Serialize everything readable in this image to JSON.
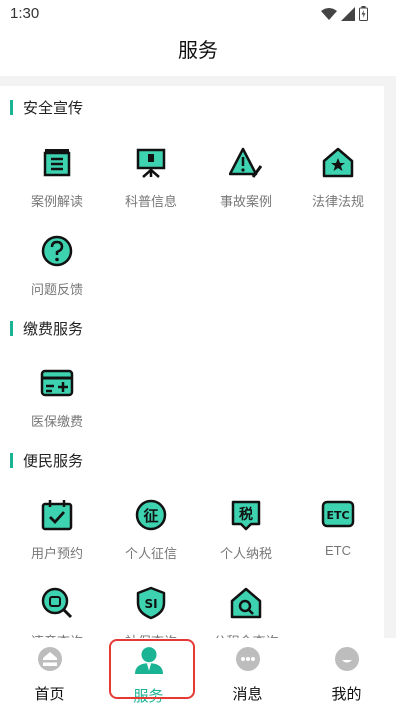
{
  "status_bar": {
    "time": "1:30"
  },
  "header": {
    "title": "服务"
  },
  "sections": [
    {
      "title": "安全宣传",
      "items": [
        {
          "label": "案例解读",
          "icon": "document-list-icon"
        },
        {
          "label": "科普信息",
          "icon": "presentation-board-icon"
        },
        {
          "label": "事故案例",
          "icon": "warning-pen-icon"
        },
        {
          "label": "法律法规",
          "icon": "house-star-icon"
        },
        {
          "label": "问题反馈",
          "icon": "question-circle-icon"
        }
      ]
    },
    {
      "title": "缴费服务",
      "items": [
        {
          "label": "医保缴费",
          "icon": "card-plus-icon"
        }
      ]
    },
    {
      "title": "便民服务",
      "items": [
        {
          "label": "用户预约",
          "icon": "calendar-check-icon"
        },
        {
          "label": "个人征信",
          "icon": "credit-circle-icon"
        },
        {
          "label": "个人纳税",
          "icon": "tax-seal-icon"
        },
        {
          "label": "ETC",
          "icon": "etc-icon"
        },
        {
          "label": "违章查询",
          "icon": "violation-search-icon"
        },
        {
          "label": "社保查询",
          "icon": "social-security-shield-icon"
        },
        {
          "label": "公积金查询",
          "icon": "house-search-icon"
        }
      ]
    }
  ],
  "tabs": [
    {
      "label": "首页",
      "icon": "home-icon",
      "active": false
    },
    {
      "label": "服务",
      "icon": "person-icon",
      "active": true
    },
    {
      "label": "消息",
      "icon": "message-dots-icon",
      "active": false
    },
    {
      "label": "我的",
      "icon": "profile-icon",
      "active": false
    }
  ],
  "colors": {
    "accent": "#1ab394",
    "icon_fill": "#3dd3b0",
    "highlight": "#e53935",
    "tab_icon": "#bdbdbd"
  }
}
